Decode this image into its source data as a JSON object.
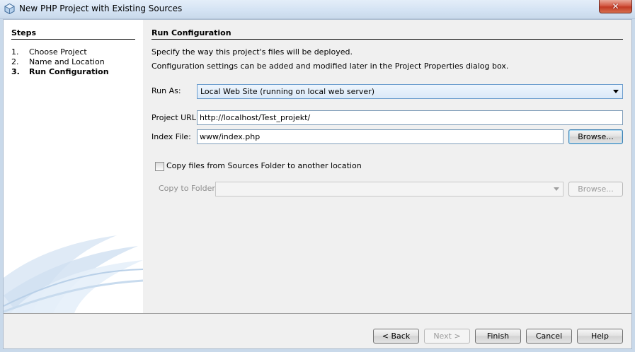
{
  "window": {
    "title": "New PHP Project with Existing Sources",
    "close_symbol": "✕",
    "icon": "netbeans-cube-icon"
  },
  "steps": {
    "title": "Steps",
    "items": [
      {
        "num": "1.",
        "label": "Choose Project",
        "current": false
      },
      {
        "num": "2.",
        "label": "Name and Location",
        "current": false
      },
      {
        "num": "3.",
        "label": "Run Configuration",
        "current": true
      }
    ]
  },
  "panel": {
    "title": "Run Configuration",
    "line1": "Specify the way this project's files will be deployed.",
    "line2": "Configuration settings can be added and modified later in the Project Properties dialog box."
  },
  "form": {
    "run_as_label": "Run As:",
    "run_as_value": "Local Web Site (running on local web server)",
    "project_url_label": "Project URL:",
    "project_url_value": "http://localhost/Test_projekt/",
    "index_file_label": "Index File:",
    "index_file_value": "www/index.php",
    "browse_label": "Browse...",
    "copy_checkbox_label": "Copy files from Sources Folder to another location",
    "copy_checked": false,
    "copy_to_label": "Copy to Folder:",
    "copy_to_value": "",
    "copy_browse_label": "Browse..."
  },
  "buttons": {
    "back": "< Back",
    "next": "Next >",
    "finish": "Finish",
    "cancel": "Cancel",
    "help": "Help"
  },
  "colors": {
    "title_bar": "#d3e2f3",
    "close_button": "#c8452f",
    "panel_bg": "#f0f0f0",
    "swoosh": "#c9ddef"
  }
}
